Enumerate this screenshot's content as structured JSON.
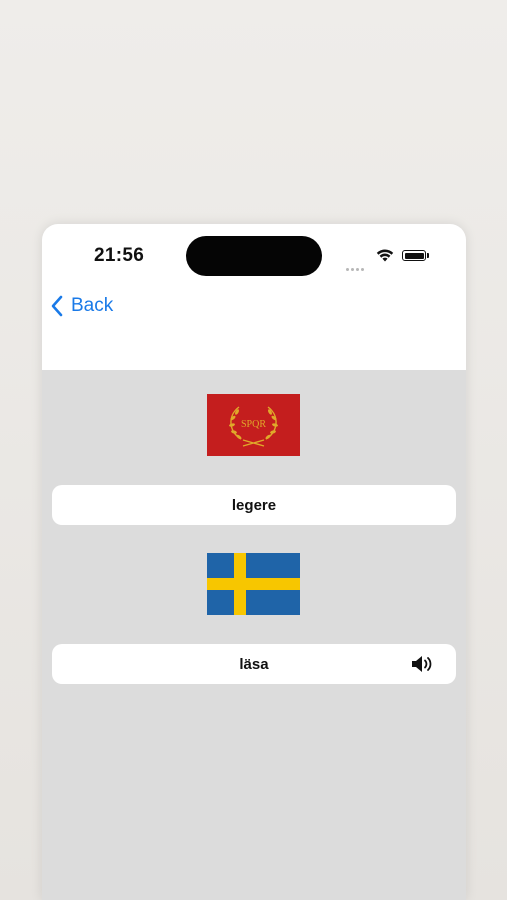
{
  "status_bar": {
    "time": "21:56",
    "icons": [
      "cellular-dots-icon",
      "wifi-icon",
      "battery-icon"
    ]
  },
  "nav": {
    "back_label": "Back",
    "accent_color": "#1a7ae8"
  },
  "source": {
    "flag": "roman-spqr-flag-icon",
    "word": "legere"
  },
  "target": {
    "flag": "sweden-flag-icon",
    "word": "läsa",
    "audio_icon": "speaker-icon"
  },
  "colors": {
    "content_background": "#dcdcdc",
    "card_background": "#ffffff",
    "spqr_red": "#c41e1e",
    "spqr_gold": "#e0a92a",
    "sweden_blue": "#1f64a8",
    "sweden_yellow": "#f7c600"
  }
}
